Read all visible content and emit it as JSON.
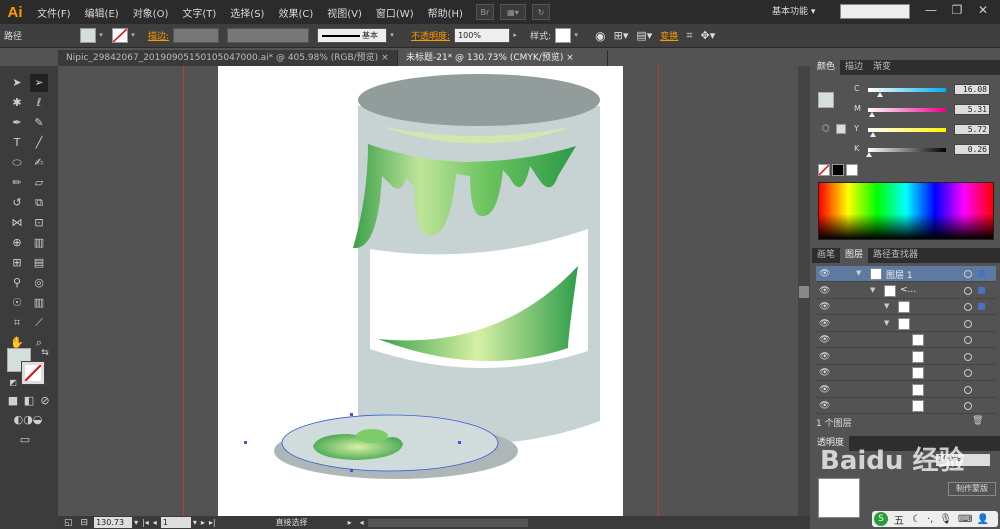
{
  "app": {
    "logo": "Ai"
  },
  "menu": [
    "文件(F)",
    "编辑(E)",
    "对象(O)",
    "文字(T)",
    "选择(S)",
    "效果(C)",
    "视图(V)",
    "窗口(W)",
    "帮助(H)"
  ],
  "menubar_right": {
    "workspace": "基本功能",
    "workspace_arrow": "▾",
    "search_placeholder": "",
    "minimize": "—",
    "maximize": "❐",
    "close": "✕"
  },
  "controlbar": {
    "path_label": "路径",
    "stroke_label": "描边:",
    "stroke_style": "基本",
    "opacity_label": "不透明度:",
    "opacity_value": "100%",
    "style_label": "样式:",
    "transform_label": "变换",
    "fill_color": "#d4dedd"
  },
  "tabs": [
    {
      "label": "Nipic_29842067_20190905150105047000.ai* @ 405.98% (RGB/预览)",
      "close": "×"
    },
    {
      "label": "未标题-21* @ 130.73% (CMYK/预览)",
      "close": "×",
      "active": true
    }
  ],
  "status": {
    "zoom": "130.73",
    "page": "1",
    "tool": "直接选择"
  },
  "color_panel": {
    "tabs": [
      "颜色",
      "描边",
      "渐变"
    ],
    "channels": [
      {
        "name": "C",
        "value": "16.08",
        "fraction": 0.16,
        "track": "linear-gradient(to right,#fff,#00aeef)"
      },
      {
        "name": "M",
        "value": "5.31",
        "fraction": 0.05,
        "track": "linear-gradient(to right,#fff,#ec008c)"
      },
      {
        "name": "Y",
        "value": "5.72",
        "fraction": 0.06,
        "track": "linear-gradient(to right,#fff,#fff200)"
      },
      {
        "name": "K",
        "value": "0.26",
        "fraction": 0.01,
        "track": "linear-gradient(to right,#fff,#000)"
      }
    ]
  },
  "layers_panel": {
    "tabs": [
      "画笔",
      "图层",
      "路径查找器"
    ],
    "rows": [
      {
        "name": "图层 1",
        "indent": 0,
        "selected": true
      },
      {
        "name": "<...",
        "indent": 1
      },
      {
        "name": "",
        "indent": 2
      },
      {
        "name": "",
        "indent": 2
      },
      {
        "name": "",
        "indent": 3
      },
      {
        "name": "",
        "indent": 3
      },
      {
        "name": "",
        "indent": 3
      },
      {
        "name": "",
        "indent": 3
      },
      {
        "name": "",
        "indent": 3
      }
    ],
    "footer": "1 个图层"
  },
  "bottom_panel": {
    "tab": "透明度",
    "opacity": "100%",
    "make_mask": "制作蒙版"
  },
  "watermark": "Baidu 经验",
  "ime": {
    "label": "五"
  }
}
